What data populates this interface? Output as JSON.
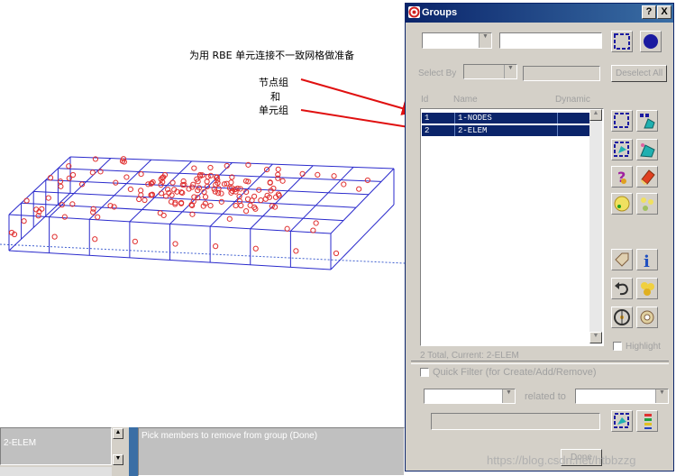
{
  "annotations": {
    "heading": "为用  RBE  单元连接不一致网格做准备",
    "node_group": "节点组",
    "and": "和",
    "element_group": "单元组"
  },
  "dialog": {
    "title": "Groups",
    "help_button": "?",
    "close_button": "X",
    "select_by_label": "Select By",
    "deselect_all_label": "Deselect All",
    "columns": [
      "Id",
      "Name",
      "Dynamic"
    ],
    "rows": [
      {
        "id": "1",
        "name": "1-NODES"
      },
      {
        "id": "2",
        "name": "2-ELEM"
      }
    ],
    "status_line": "2 Total, Current: 2-ELEM",
    "highlight_label": "Highlight",
    "quick_filter_label": "Quick Filter (for Create/Add/Remove)",
    "related_to_label": "related to"
  },
  "bottom": {
    "left_label": "2-ELEM",
    "prompt": "Pick members to remove from group (Done)",
    "done_label": "Done"
  },
  "watermark": "https://blog.csdn.net/htbbzzg",
  "colors": {
    "title_bar": "#0a246a",
    "selection": "#0a246a",
    "mesh_lines": "#2222cc",
    "nodes": "#e03030",
    "arrows": "#e01010"
  }
}
